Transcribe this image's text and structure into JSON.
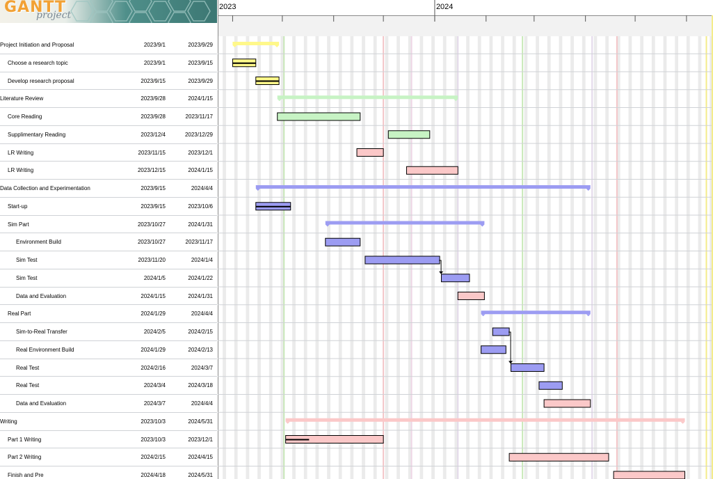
{
  "app": {
    "brand": "GANTT",
    "subtitle": "project"
  },
  "timeline": {
    "start": "2023-08-23",
    "end": "2024-06-17",
    "year_labels": [
      {
        "label": "2023",
        "date": "2023-08-23"
      },
      {
        "label": "2024",
        "date": "2024-01-01"
      }
    ],
    "today_date": "2024-06-13",
    "highlight_lines": [
      {
        "date": "2023-10-02",
        "color": "#c8e8b8"
      },
      {
        "date": "2023-12-01",
        "color": "#f3c5c8"
      },
      {
        "date": "2023-12-18",
        "color": "#eed6e6"
      },
      {
        "date": "2024-01-15",
        "color": "#e3d9ea"
      },
      {
        "date": "2024-02-23",
        "color": "#c8e8b8"
      },
      {
        "date": "2024-04-05",
        "color": "#e3d9ea"
      },
      {
        "date": "2024-04-20",
        "color": "#f3c5c8"
      }
    ]
  },
  "colors": {
    "yellow": "#fff88a",
    "green": "#c7f3c4",
    "pink": "#fbc8c8",
    "blue": "#9c9cf2"
  },
  "tasks": [
    {
      "name": "Project Initiation and Proposal",
      "begin": "2023/9/1",
      "end": "2023/9/29",
      "level": 0,
      "kind": "summary",
      "color": "yellow"
    },
    {
      "name": "Choose a research topic",
      "begin": "2023/9/1",
      "end": "2023/9/15",
      "level": 1,
      "kind": "task",
      "color": "yellow",
      "progress": 1.0
    },
    {
      "name": "Develop research proposal",
      "begin": "2023/9/15",
      "end": "2023/9/29",
      "level": 1,
      "kind": "task",
      "color": "yellow",
      "progress": 1.0
    },
    {
      "name": "Literature Review",
      "begin": "2023/9/28",
      "end": "2024/1/15",
      "level": 0,
      "kind": "summary",
      "color": "green"
    },
    {
      "name": "Core Reading",
      "begin": "2023/9/28",
      "end": "2023/11/17",
      "level": 1,
      "kind": "task",
      "color": "green"
    },
    {
      "name": "Supplimentary Reading",
      "begin": "2023/12/4",
      "end": "2023/12/29",
      "level": 1,
      "kind": "task",
      "color": "green"
    },
    {
      "name": "LR Writing",
      "begin": "2023/11/15",
      "end": "2023/12/1",
      "level": 1,
      "kind": "task",
      "color": "pink"
    },
    {
      "name": "LR Writing",
      "begin": "2023/12/15",
      "end": "2024/1/15",
      "level": 1,
      "kind": "task",
      "color": "pink"
    },
    {
      "name": "Data Collection and Experimentation",
      "begin": "2023/9/15",
      "end": "2024/4/4",
      "level": 0,
      "kind": "summary",
      "color": "blue"
    },
    {
      "name": "Start-up",
      "begin": "2023/9/15",
      "end": "2023/10/6",
      "level": 1,
      "kind": "task",
      "color": "blue",
      "progress": 1.0
    },
    {
      "name": "Sim Part",
      "begin": "2023/10/27",
      "end": "2024/1/31",
      "level": 1,
      "kind": "summary",
      "color": "blue"
    },
    {
      "name": "Environment Build",
      "begin": "2023/10/27",
      "end": "2023/11/17",
      "level": 2,
      "kind": "task",
      "color": "blue"
    },
    {
      "name": "Sim Test",
      "begin": "2023/11/20",
      "end": "2024/1/4",
      "level": 2,
      "kind": "task",
      "color": "blue"
    },
    {
      "name": "Sim Test",
      "begin": "2024/1/5",
      "end": "2024/1/22",
      "level": 2,
      "kind": "task",
      "color": "blue"
    },
    {
      "name": "Data and Evaluation",
      "begin": "2024/1/15",
      "end": "2024/1/31",
      "level": 2,
      "kind": "task",
      "color": "pink"
    },
    {
      "name": "Real Part",
      "begin": "2024/1/29",
      "end": "2024/4/4",
      "level": 1,
      "kind": "summary",
      "color": "blue"
    },
    {
      "name": "Sim-to-Real Transfer",
      "begin": "2024/2/5",
      "end": "2024/2/15",
      "level": 2,
      "kind": "task",
      "color": "blue"
    },
    {
      "name": "Real Environment Build",
      "begin": "2024/1/29",
      "end": "2024/2/13",
      "level": 2,
      "kind": "task",
      "color": "blue"
    },
    {
      "name": "Real Test",
      "begin": "2024/2/16",
      "end": "2024/3/7",
      "level": 2,
      "kind": "task",
      "color": "blue"
    },
    {
      "name": "Real Test",
      "begin": "2024/3/4",
      "end": "2024/3/18",
      "level": 2,
      "kind": "task",
      "color": "blue"
    },
    {
      "name": "Data and Evaluation",
      "begin": "2024/3/7",
      "end": "2024/4/4",
      "level": 2,
      "kind": "task",
      "color": "pink"
    },
    {
      "name": "Writing",
      "begin": "2023/10/3",
      "end": "2024/5/31",
      "level": 0,
      "kind": "summary",
      "color": "pink"
    },
    {
      "name": "Part 1 Writing",
      "begin": "2023/10/3",
      "end": "2023/12/1",
      "level": 1,
      "kind": "task",
      "color": "pink",
      "progress": 0.24
    },
    {
      "name": "Part 2 Writing",
      "begin": "2024/2/15",
      "end": "2024/4/15",
      "level": 1,
      "kind": "task",
      "color": "pink"
    },
    {
      "name": "Finish and Pre",
      "begin": "2024/4/18",
      "end": "2024/5/31",
      "level": 1,
      "kind": "task",
      "color": "pink"
    }
  ],
  "dependencies": [
    {
      "from": 12,
      "to": 13
    },
    {
      "from": 16,
      "to": 18
    }
  ]
}
